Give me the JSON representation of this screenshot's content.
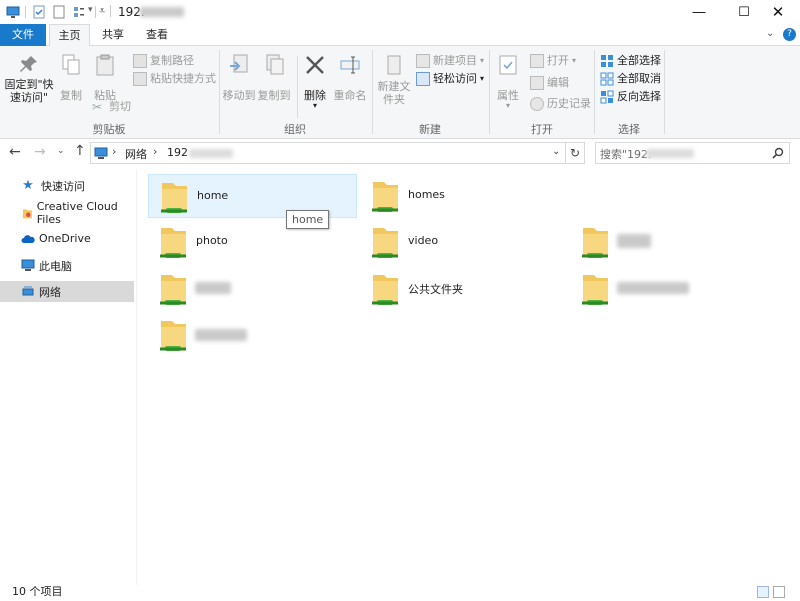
{
  "window": {
    "title_prefix": "192.",
    "colors": {
      "accent": "#1979ca",
      "selection": "#e5f3ff",
      "ribbon_bg": "#f5f6f7"
    }
  },
  "ribbon_tabs": [
    "文件",
    "主页",
    "共享",
    "查看"
  ],
  "ribbon": {
    "clipboard": {
      "label": "剪贴板",
      "pin_quick_access": "固定到\"快速访问\"",
      "copy": "复制",
      "paste": "粘贴",
      "copy_path": "复制路径",
      "paste_shortcut": "粘贴快捷方式",
      "cut": "剪切"
    },
    "organize": {
      "label": "组织",
      "move_to": "移动到",
      "copy_to": "复制到",
      "delete": "删除",
      "rename": "重命名"
    },
    "new": {
      "label": "新建",
      "new_folder": "新建文件夹",
      "new_item": "新建项目",
      "easy_access": "轻松访问"
    },
    "open": {
      "label": "打开",
      "properties": "属性",
      "open": "打开",
      "edit": "编辑",
      "history": "历史记录"
    },
    "select": {
      "label": "选择",
      "select_all": "全部选择",
      "select_none": "全部取消",
      "invert": "反向选择"
    }
  },
  "address": {
    "root": "网络",
    "separator": "›",
    "host_prefix": "192",
    "search_placeholder": "搜索\"192."
  },
  "nav_pane": [
    {
      "label": "快速访问",
      "icon": "star-icon"
    },
    {
      "label": "Creative Cloud Files",
      "icon": "creative-cloud-icon"
    },
    {
      "label": "OneDrive",
      "icon": "cloud-icon"
    },
    {
      "label": "此电脑",
      "icon": "computer-icon"
    },
    {
      "label": "网络",
      "icon": "network-icon",
      "selected": true
    }
  ],
  "folders": [
    "home",
    "homes",
    "photo",
    "video",
    "公共文件夹"
  ],
  "tooltip": "home",
  "status": {
    "item_count": "10 个项目"
  }
}
